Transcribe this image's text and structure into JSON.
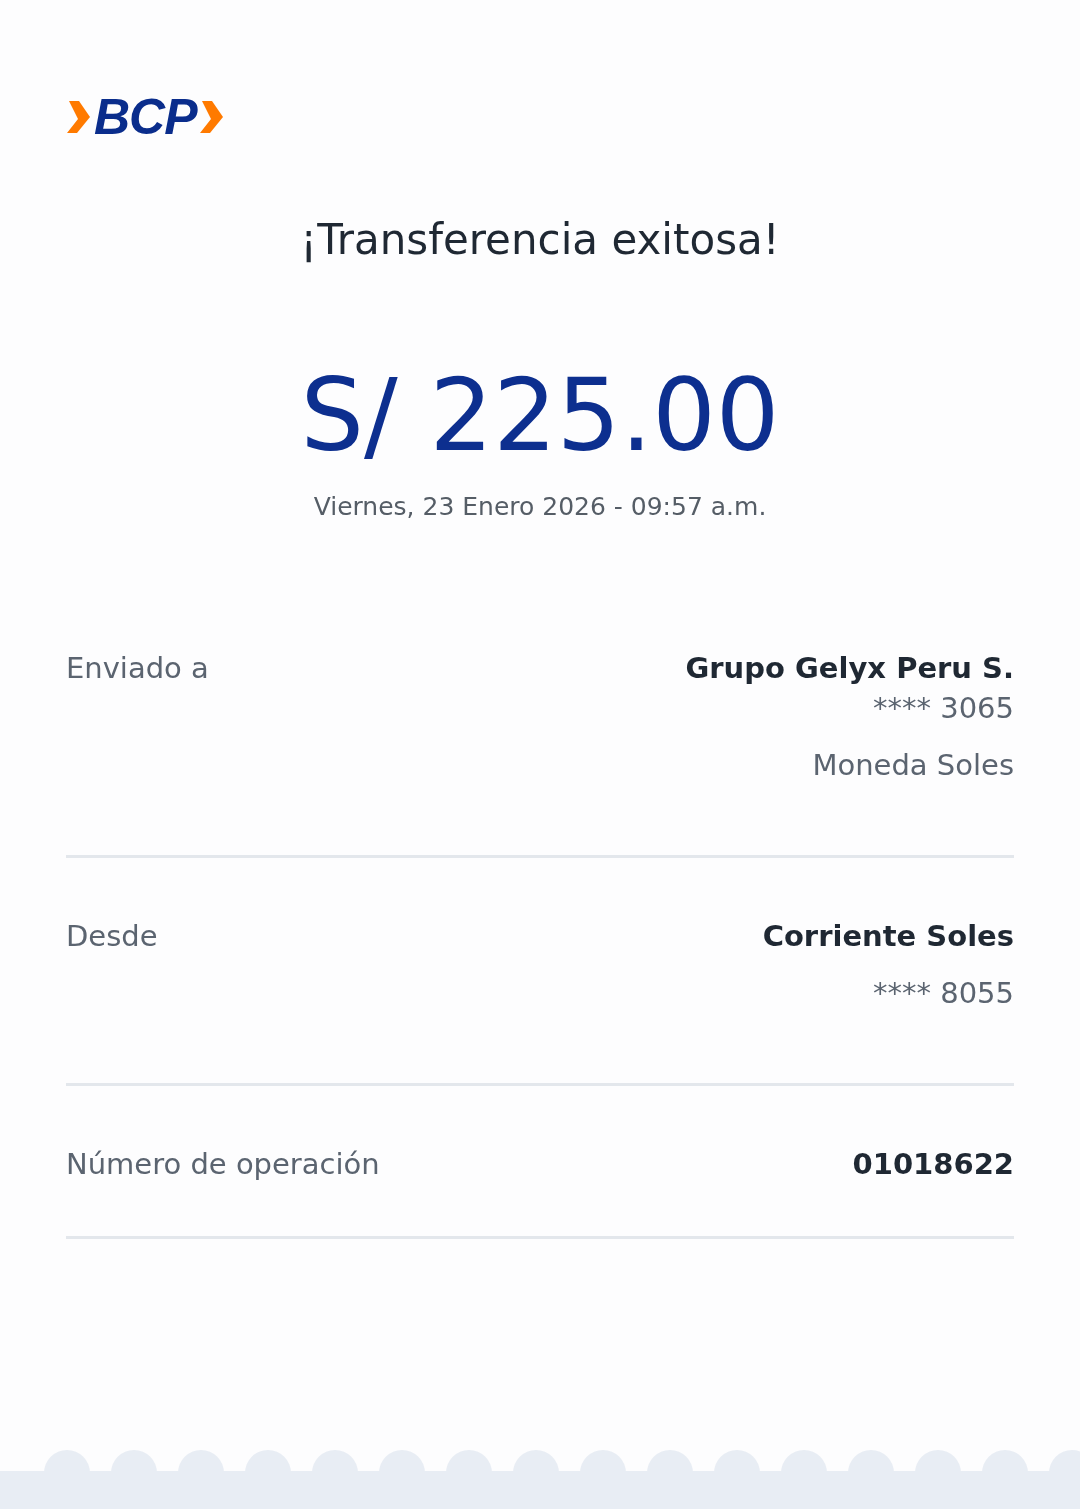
{
  "logo": {
    "text": "BCP"
  },
  "title": "¡Transferencia exitosa!",
  "amount": "S/ 225.00",
  "date": "Viernes, 23 Enero 2026 - 09:57 a.m.",
  "details": [
    {
      "label": "Enviado a",
      "lines": [
        {
          "text": "Grupo Gelyx Peru S.",
          "kind": "primary"
        },
        {
          "text": "**** 3065",
          "kind": "secondary"
        },
        {
          "text": "Moneda Soles",
          "kind": "note"
        }
      ]
    },
    {
      "label": "Desde",
      "lines": [
        {
          "text": "Corriente Soles",
          "kind": "primary"
        },
        {
          "text": "**** 8055",
          "kind": "note"
        }
      ]
    },
    {
      "label": "Número de operación",
      "lines": [
        {
          "text": "01018622",
          "kind": "primary"
        }
      ]
    }
  ]
}
